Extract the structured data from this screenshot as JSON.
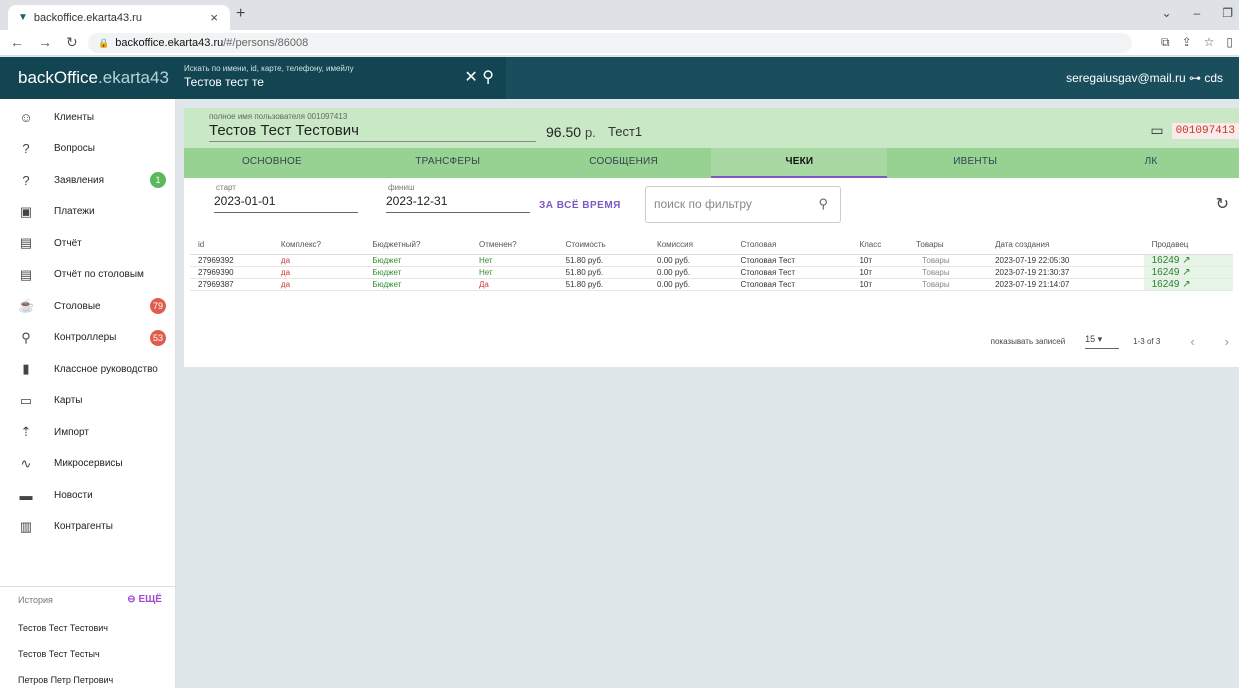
{
  "browser": {
    "tab_title": "backoffice.ekarta43.ru",
    "url_host": "backoffice.ekarta43.ru",
    "url_path": "/#/persons/86008"
  },
  "header": {
    "logo_main": "backOffice",
    "logo_sub": ".ekarta43",
    "search_placeholder": "Искать по имени, id, карте, телефону, имейлу",
    "search_value": "Тестов тест те",
    "user": "seregaiusgav@mail.ru ⊶ cds"
  },
  "sidebar": {
    "items": [
      {
        "label": "Клиенты",
        "icon": "☺",
        "badge": ""
      },
      {
        "label": "Вопросы",
        "icon": "?",
        "badge": ""
      },
      {
        "label": "Заявления",
        "icon": "?",
        "badge": "1",
        "badge_color": "#5cb85c"
      },
      {
        "label": "Платежи",
        "icon": "▣",
        "badge": ""
      },
      {
        "label": "Отчёт",
        "icon": "▤",
        "badge": ""
      },
      {
        "label": "Отчёт по столовым",
        "icon": "▤",
        "badge": ""
      },
      {
        "label": "Столовые",
        "icon": "☕",
        "badge": "79",
        "badge_color": "#e05d4c"
      },
      {
        "label": "Контроллеры",
        "icon": "⚲",
        "badge": "53",
        "badge_color": "#e05d4c"
      },
      {
        "label": "Классное руководство",
        "icon": "▮",
        "badge": ""
      },
      {
        "label": "Карты",
        "icon": "▭",
        "badge": ""
      },
      {
        "label": "Импорт",
        "icon": "⇡",
        "badge": ""
      },
      {
        "label": "Микросервисы",
        "icon": "∿",
        "badge": ""
      },
      {
        "label": "Новости",
        "icon": "▬",
        "badge": ""
      },
      {
        "label": "Контрагенты",
        "icon": "▥",
        "badge": ""
      }
    ],
    "history_label": "История",
    "history_more": "⊖ ЕЩЁ",
    "history": [
      "Тестов Тест Тестович",
      "Тестов Тест Тестыч",
      "Петров Петр Петрович"
    ]
  },
  "person": {
    "fullname_label": "полное имя пользователя 001097413",
    "fullname": "Тестов Тест Тестович",
    "balance": "96.50",
    "currency": "р.",
    "org": "Тест1",
    "card_number": "001097413"
  },
  "tabs": [
    "ОСНОВНОЕ",
    "ТРАНСФЕРЫ",
    "СООБЩЕНИЯ",
    "ЧЕКИ",
    "ИВЕНТЫ",
    "ЛК"
  ],
  "active_tab": 3,
  "filters": {
    "start_label": "старт",
    "start_value": "2023-01-01",
    "end_label": "финиш",
    "end_value": "2023-12-31",
    "all_time": "ЗА ВСЁ ВРЕМЯ",
    "filter_placeholder": "поиск по фильтру"
  },
  "table": {
    "headers": [
      "id",
      "Комплекс?",
      "Бюджетный?",
      "Отменен?",
      "Стоимость",
      "Комиссия",
      "Столовая",
      "Класс",
      "Товары",
      "Дата создания",
      "Продавец"
    ],
    "rows": [
      [
        "27969392",
        "да",
        "Бюджет",
        "Нет",
        "51.80 руб.",
        "0.00 руб.",
        "Столовая Тест",
        "10т",
        "Товары",
        "2023-07-19 22:05:30",
        "16249 ↗"
      ],
      [
        "27969390",
        "да",
        "Бюджет",
        "Нет",
        "51.80 руб.",
        "0.00 руб.",
        "Столовая Тест",
        "10т",
        "Товары",
        "2023-07-19 21:30:37",
        "16249 ↗"
      ],
      [
        "27969387",
        "да",
        "Бюджет",
        "Да",
        "51.80 руб.",
        "0.00 руб.",
        "Столовая Тест",
        "10т",
        "Товары",
        "2023-07-19 21:14:07",
        "16249 ↗"
      ]
    ]
  },
  "pager": {
    "label": "показывать записей",
    "per_page": "15 ▾",
    "range": "1-3 of 3",
    "prev": "‹",
    "next": "›"
  }
}
